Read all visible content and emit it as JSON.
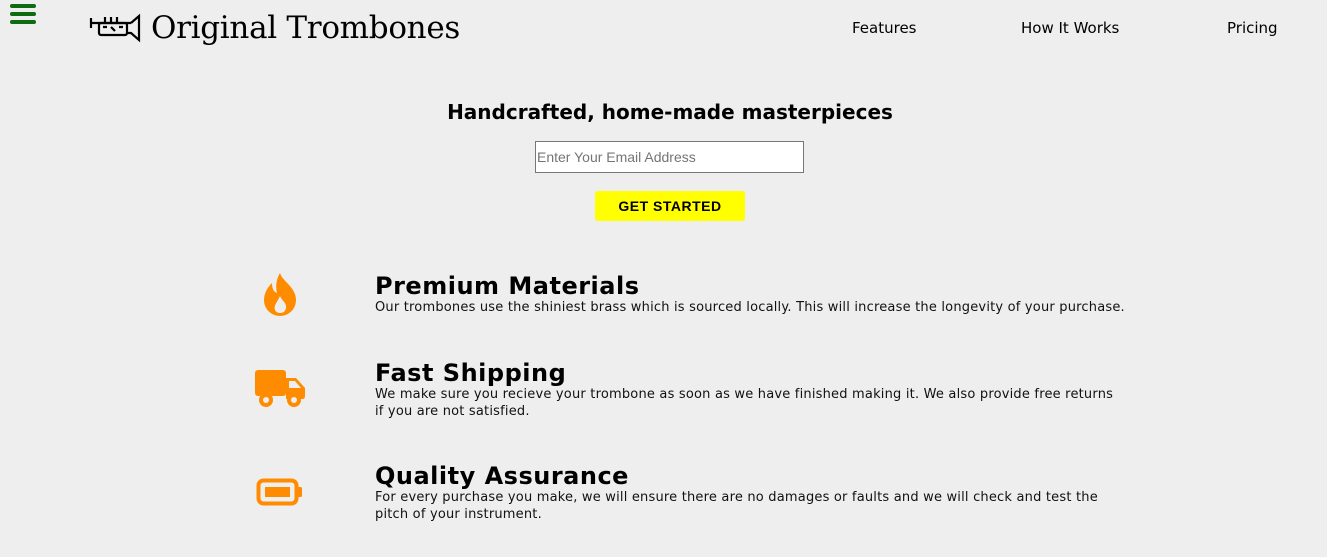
{
  "header": {
    "brand_name": "Original Trombones",
    "nav": {
      "features": "Features",
      "how_it_works": "How It Works",
      "pricing": "Pricing"
    },
    "menu_icon": "hamburger-icon",
    "logo_icon": "trumpet-icon"
  },
  "hero": {
    "title": "Handcrafted, home-made masterpieces",
    "email_placeholder": "Enter Your Email Address",
    "cta_label": "GET STARTED"
  },
  "features": [
    {
      "icon": "flame-icon",
      "title": "Premium Materials",
      "description": "Our trombones use the shiniest brass which is sourced locally. This will increase the longevity of your purchase."
    },
    {
      "icon": "truck-icon",
      "title": "Fast Shipping",
      "description": "We make sure you recieve your trombone as soon as we have finished making it. We also provide free returns if you are not satisfied."
    },
    {
      "icon": "battery-icon",
      "title": "Quality Assurance",
      "description": "For every purchase you make, we will ensure there are no damages or faults and we will check and test the pitch of your instrument."
    }
  ],
  "colors": {
    "background": "#eeeeee",
    "accent_icon": "#ff8c00",
    "cta_background": "#ffff00",
    "menu_icon": "#0f6b0f"
  }
}
